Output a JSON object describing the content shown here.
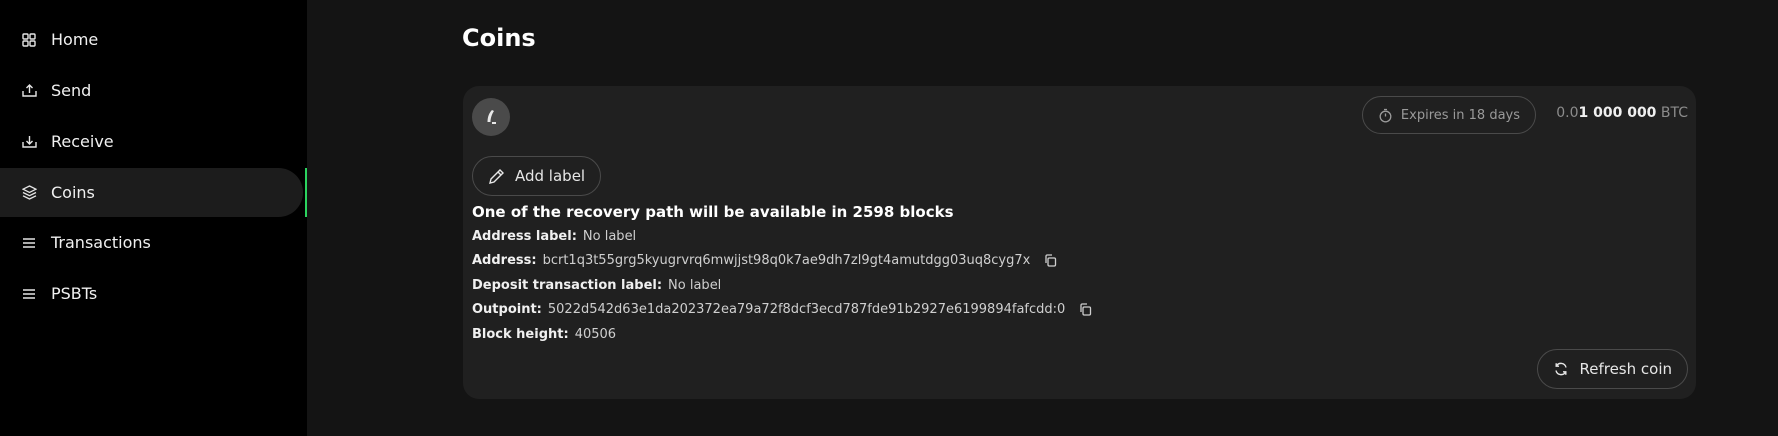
{
  "sidebar": {
    "items": [
      {
        "label": "Home",
        "icon": "grid-icon"
      },
      {
        "label": "Send",
        "icon": "send-icon"
      },
      {
        "label": "Receive",
        "icon": "receive-icon"
      },
      {
        "label": "Coins",
        "icon": "coins-icon",
        "active": true
      },
      {
        "label": "Transactions",
        "icon": "list-icon"
      },
      {
        "label": "PSBTs",
        "icon": "list-icon"
      }
    ]
  },
  "page": {
    "title": "Coins"
  },
  "coin": {
    "expires": "Expires in 18 days",
    "amount_prefix": "0.0",
    "amount_main": "1 000 000",
    "amount_unit": "BTC",
    "add_label": "Add label",
    "recovery_notice": "One of the recovery path will be available in 2598 blocks",
    "address_label_key": "Address label:",
    "address_label_value": "No label",
    "address_key": "Address:",
    "address_value": "bcrt1q3t55grg5kyugrvrq6mwjjst98q0k7ae9dh7zl9gt4amutdgg03uq8cyg7x",
    "deposit_label_key": "Deposit transaction label:",
    "deposit_label_value": "No label",
    "outpoint_key": "Outpoint:",
    "outpoint_value": "5022d542d63e1da202372ea79a72f8dcf3ecd787fde91b2927e6199894fafcdd:0",
    "block_height_key": "Block height:",
    "block_height_value": "40506",
    "refresh_label": "Refresh coin"
  },
  "colors": {
    "accent": "#2bd35f",
    "sidebar_bg": "#000000",
    "main_bg": "#141414",
    "card_bg": "#202020"
  }
}
